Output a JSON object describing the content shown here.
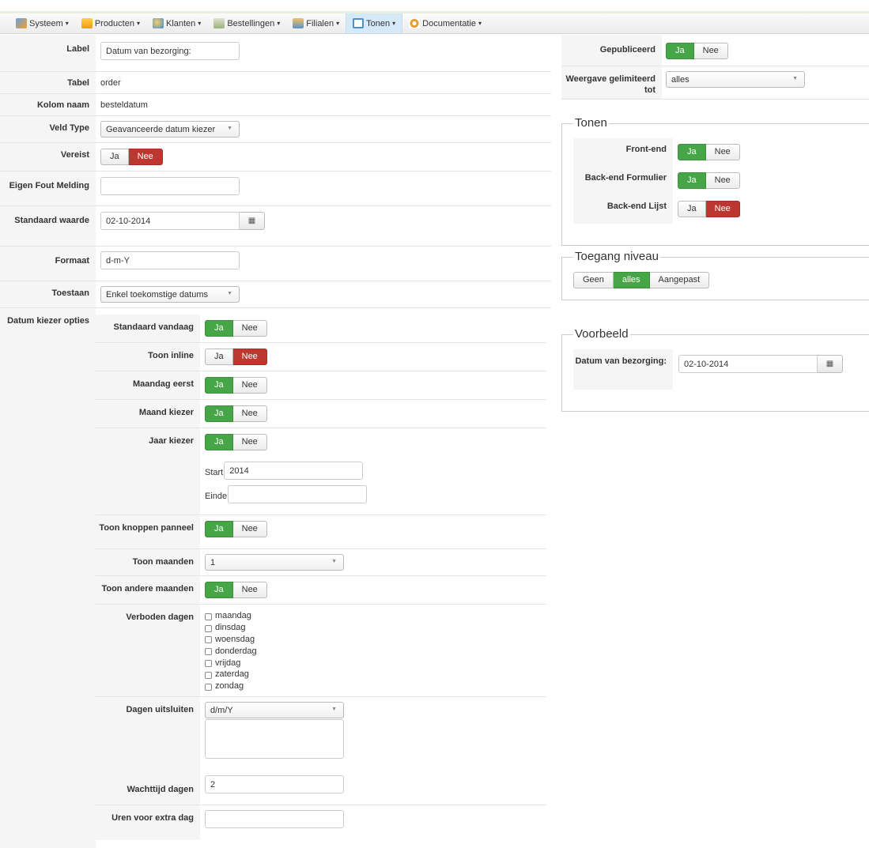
{
  "menu": [
    {
      "label": "Systeem",
      "icon": "wrench-icon",
      "color": "#3a7fd0"
    },
    {
      "label": "Producten",
      "icon": "box-icon",
      "color": "#f3a617"
    },
    {
      "label": "Klanten",
      "icon": "users-icon",
      "color": "#3b8ed3"
    },
    {
      "label": "Bestellingen",
      "icon": "order-icon",
      "color": "#8aa668"
    },
    {
      "label": "Filialen",
      "icon": "store-icon",
      "color": "#5b93c9"
    },
    {
      "label": "Tonen",
      "icon": "display-icon",
      "color": "#4d8fcf",
      "active": true
    },
    {
      "label": "Documentatie",
      "icon": "docs-icon",
      "color": "#e79b2b"
    }
  ],
  "form": {
    "label": {
      "name": "Label",
      "value": "Datum van bezorging:"
    },
    "tabel": {
      "name": "Tabel",
      "value": "order"
    },
    "kolom": {
      "name": "Kolom naam",
      "value": "besteldatum"
    },
    "veld_type": {
      "name": "Veld Type",
      "value": "Geavanceerde datum kiezer"
    },
    "vereist": {
      "name": "Vereist",
      "yes": "Ja",
      "no": "Nee",
      "selected": "Nee"
    },
    "fout": {
      "name": "Eigen Fout Melding",
      "value": ""
    },
    "standaard": {
      "name": "Standaard waarde",
      "value": "02-10-2014"
    },
    "formaat": {
      "name": "Formaat",
      "value": "d-m-Y"
    },
    "toestaan": {
      "name": "Toestaan",
      "value": "Enkel toekomstige datums"
    },
    "opties_label": "Datum kiezer opties"
  },
  "options": {
    "standaard_vandaag": {
      "name": "Standaard vandaag",
      "yes": "Ja",
      "no": "Nee",
      "selected": "Ja"
    },
    "toon_inline": {
      "name": "Toon inline",
      "yes": "Ja",
      "no": "Nee",
      "selected": "Nee"
    },
    "maandag_eerst": {
      "name": "Maandag eerst",
      "yes": "Ja",
      "no": "Nee",
      "selected": "Ja"
    },
    "maand_kiezer": {
      "name": "Maand kiezer",
      "yes": "Ja",
      "no": "Nee",
      "selected": "Ja"
    },
    "jaar_kiezer": {
      "name": "Jaar kiezer",
      "yes": "Ja",
      "no": "Nee",
      "selected": "Ja",
      "start_label": "Start",
      "start_value": "2014",
      "einde_label": "Einde",
      "einde_value": ""
    },
    "toon_knoppen": {
      "name": "Toon knoppen panneel",
      "yes": "Ja",
      "no": "Nee",
      "selected": "Ja"
    },
    "toon_maanden": {
      "name": "Toon maanden",
      "value": "1"
    },
    "toon_andere": {
      "name": "Toon andere maanden",
      "yes": "Ja",
      "no": "Nee",
      "selected": "Ja"
    },
    "verboden": {
      "name": "Verboden dagen",
      "days": [
        "maandag",
        "dinsdag",
        "woensdag",
        "donderdag",
        "vrijdag",
        "zaterdag",
        "zondag"
      ]
    },
    "uitsluiten": {
      "name": "Dagen uitsluiten",
      "value": "d/m/Y"
    },
    "wachttijd": {
      "name": "Wachttijd dagen",
      "value": "2"
    },
    "uren": {
      "name": "Uren voor extra dag",
      "value": ""
    }
  },
  "right": {
    "gepubliceerd": {
      "name": "Gepubliceerd",
      "yes": "Ja",
      "no": "Nee",
      "selected": "Ja"
    },
    "weergave": {
      "name": "Weergave gelimiteerd tot",
      "value": "alles"
    },
    "tonen": {
      "legend": "Tonen",
      "frontend": {
        "name": "Front-end",
        "yes": "Ja",
        "no": "Nee",
        "selected": "Ja"
      },
      "backend_form": {
        "name": "Back-end Formulier",
        "yes": "Ja",
        "no": "Nee",
        "selected": "Ja"
      },
      "backend_lijst": {
        "name": "Back-end Lijst",
        "yes": "Ja",
        "no": "Nee",
        "selected": "Nee"
      }
    },
    "toegang": {
      "legend": "Toegang niveau",
      "options": [
        "Geen",
        "alles",
        "Aangepast"
      ],
      "selected": "alles"
    },
    "voorbeeld": {
      "legend": "Voorbeeld",
      "name": "Datum van bezorging:",
      "value": "02-10-2014"
    }
  }
}
